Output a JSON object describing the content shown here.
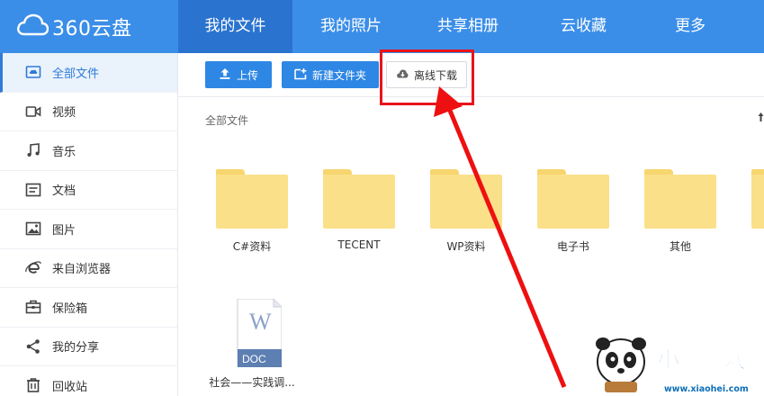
{
  "app": {
    "logo_text": "360云盘"
  },
  "nav": {
    "items": [
      {
        "label": "我的文件",
        "active": true
      },
      {
        "label": "我的照片",
        "active": false
      },
      {
        "label": "共享相册",
        "active": false
      },
      {
        "label": "云收藏",
        "active": false
      },
      {
        "label": "更多",
        "active": false
      }
    ]
  },
  "sidebar": {
    "items": [
      {
        "label": "全部文件",
        "icon": "cloud-drive-icon",
        "active": true
      },
      {
        "label": "视频",
        "icon": "video-icon",
        "active": false
      },
      {
        "label": "音乐",
        "icon": "music-note-icon",
        "active": false
      },
      {
        "label": "文档",
        "icon": "document-icon",
        "active": false
      },
      {
        "label": "图片",
        "icon": "image-icon",
        "active": false
      },
      {
        "label": "来自浏览器",
        "icon": "browser-icon",
        "active": false
      },
      {
        "label": "保险箱",
        "icon": "safe-box-icon",
        "active": false
      },
      {
        "label": "我的分享",
        "icon": "share-icon",
        "active": false
      },
      {
        "label": "回收站",
        "icon": "recycle-bin-icon",
        "active": false
      }
    ]
  },
  "toolbar": {
    "upload_label": "上传",
    "new_folder_label": "新建文件夹",
    "offline_download_label": "离线下载"
  },
  "breadcrumb": {
    "label": "全部文件"
  },
  "files": [
    {
      "name": "C#资料",
      "type": "folder"
    },
    {
      "name": "TECENT",
      "type": "folder"
    },
    {
      "name": "WP资料",
      "type": "folder"
    },
    {
      "name": "电子书",
      "type": "folder"
    },
    {
      "name": "其他",
      "type": "folder"
    },
    {
      "name": "",
      "type": "folder"
    },
    {
      "name": "社会——实践调...",
      "type": "doc",
      "badge": "DOC",
      "letter": "W"
    }
  ],
  "watermark": {
    "brand": "小黑游戏",
    "url": "www.xiaohei.com"
  },
  "colors": {
    "topbar": "#3b8ee8",
    "nav_active": "#2a73cf",
    "button_primary": "#2e87e4",
    "folder": "#fbe08a",
    "highlight_red": "#e8141b",
    "sidebar_active": "#2f7bd8"
  }
}
